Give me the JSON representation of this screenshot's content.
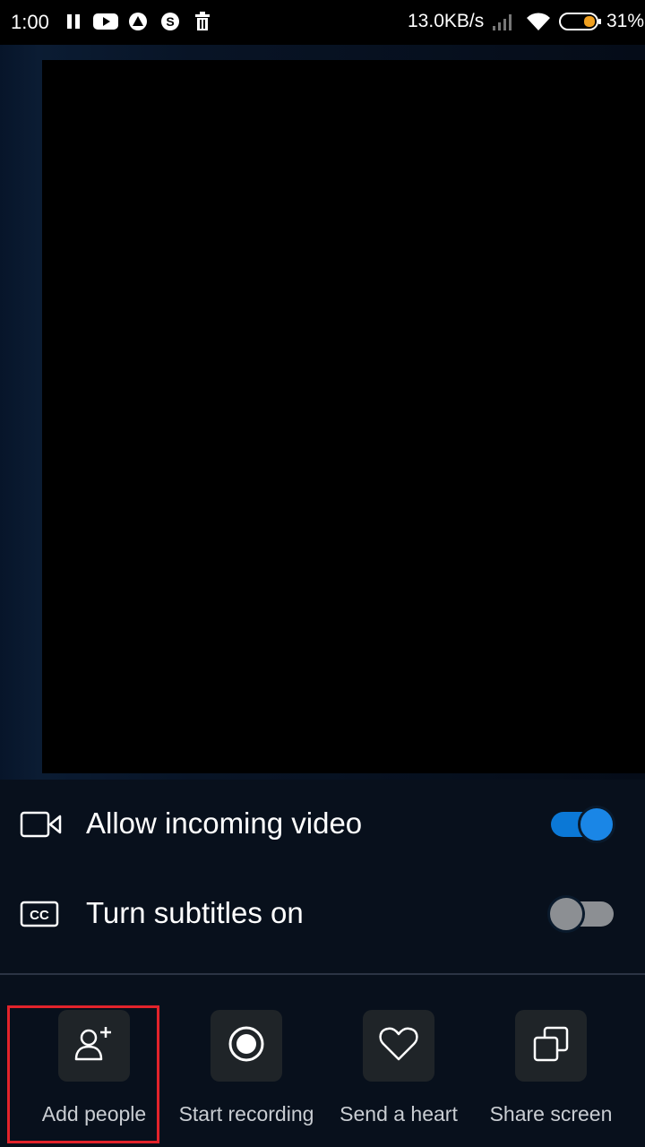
{
  "status_bar": {
    "time": "1:00",
    "left_icons": [
      "pause-icon",
      "youtube-icon",
      "app-a-icon",
      "skype-icon",
      "trash-icon"
    ],
    "net_speed": "13.0KB/s",
    "battery_percent": "31%",
    "battery_fill_fraction": 0.31
  },
  "call": {
    "video": "black"
  },
  "options": [
    {
      "label": "Allow incoming video",
      "icon": "video-camera-icon",
      "on": true
    },
    {
      "label": "Turn subtitles on",
      "icon": "closed-captions-icon",
      "on": false
    }
  ],
  "actions": [
    {
      "label": "Add people",
      "icon": "add-person-icon",
      "highlighted": true
    },
    {
      "label": "Start recording",
      "icon": "record-icon",
      "highlighted": false
    },
    {
      "label": "Send a heart",
      "icon": "heart-icon",
      "highlighted": false
    },
    {
      "label": "Share screen",
      "icon": "share-screen-icon",
      "highlighted": false
    }
  ],
  "colors": {
    "accent": "#0b78d6",
    "highlight": "#e3232b",
    "toggle_off": "#8c8f93"
  }
}
